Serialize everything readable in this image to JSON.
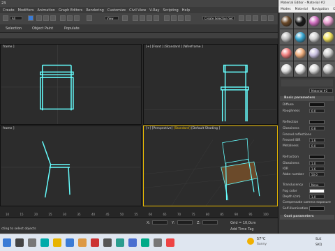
{
  "window_title": "23",
  "menu": [
    "Create",
    "Modifiers",
    "Animation",
    "Graph Editors",
    "Rendering",
    "Customize",
    "Civil View",
    "V-Ray",
    "Scripting",
    "Help"
  ],
  "toolbar": {
    "filter_select": "All",
    "view_select": "View",
    "selection_set": "Create Selection Set"
  },
  "ribbon": [
    "Selection",
    "Object Paint",
    "Populate"
  ],
  "viewports": {
    "top_left": {
      "label": "frame ]"
    },
    "top_right": {
      "label_parts": [
        "[+] [Front ] [Standard ] [Wireframe ]"
      ]
    },
    "bottom_left": {
      "label": "frame ]"
    },
    "bottom_right": {
      "prefix": "[+] [Perspective] ",
      "active": "[Standard]",
      "suffix": " [Default Shading ]"
    }
  },
  "timeline_ticks": [
    "10",
    "15",
    "20",
    "25",
    "30",
    "35",
    "40",
    "45",
    "50",
    "55",
    "60",
    "65",
    "70",
    "75",
    "80",
    "85",
    "90",
    "95",
    "100"
  ],
  "status": {
    "left_text": "cting to select objects",
    "grid": "Grid = 10,0cm",
    "add_time_tag": "Add Time Tag",
    "xyz": [
      "X:",
      "Y:",
      "Z:"
    ]
  },
  "material_editor": {
    "title": "Material Editor - Material #2",
    "menu": [
      "Modes",
      "Material",
      "Navigation",
      "O"
    ],
    "material_name": "Material #2",
    "sections": {
      "basic": "Basic parameters",
      "coat": "Coat parameters"
    },
    "params": [
      {
        "label": "Diffuse",
        "value": ""
      },
      {
        "label": "Roughness",
        "value": "0.0"
      },
      {
        "label": "Reflection",
        "value": ""
      },
      {
        "label": "Glossiness",
        "value": "0.8"
      },
      {
        "label": "Fresnel reflections",
        "value": ""
      },
      {
        "label": "Fresnel IOR",
        "value": "1.6"
      },
      {
        "label": "Metalness",
        "value": "0.0"
      },
      {
        "label": "Refraction",
        "value": ""
      },
      {
        "label": "Glossiness",
        "value": "1.0"
      },
      {
        "label": "IOR",
        "value": "1.6"
      },
      {
        "label": "Abbe number",
        "value": "50.0"
      },
      {
        "label": "Translucency",
        "value": "None"
      },
      {
        "label": "Fog color",
        "value": ""
      },
      {
        "label": "Depth (cm)",
        "value": "1.0"
      },
      {
        "label": "Compensate camera exposure",
        "value": ""
      },
      {
        "label": "Self-illumination",
        "value": ""
      }
    ],
    "sphere_colors": [
      "#6b4a2a",
      "#1a1a1a",
      "#d070c0",
      "#e8a0d0",
      "#c0c0c0",
      "#3aa6d0",
      "#d2d2d2",
      "#f0e060",
      "#f08080",
      "#f0b080",
      "#c8c0e0",
      "#d0d0d0",
      "#e0e0e0",
      "#eeeeee",
      "#d8d8d8",
      "#c8c8c8"
    ]
  },
  "taskbar": {
    "weather_temp": "57°C",
    "weather_desc": "Sunny",
    "lang_top": "SLK",
    "lang_bottom": "SKQ"
  }
}
